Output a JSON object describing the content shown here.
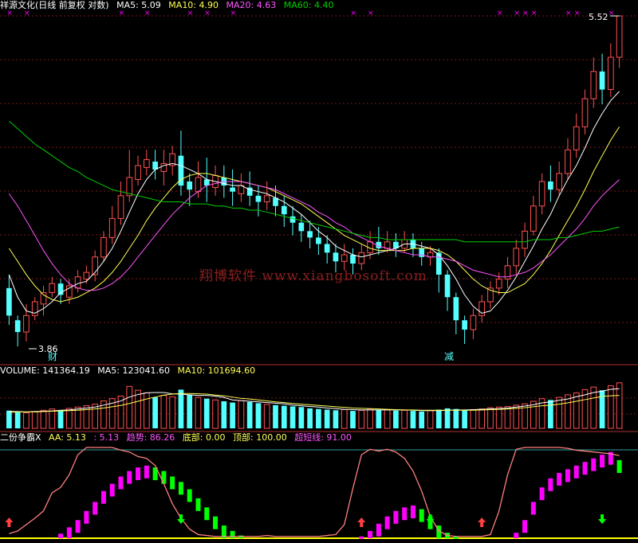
{
  "price_header": {
    "name": "祥源文化(日线 前复权 对数)",
    "ma5": "MA5: 5.09",
    "ma10": "MA10: 4.90",
    "ma20": "MA20: 4.63",
    "ma60": "MA60: 4.40"
  },
  "volume_header": {
    "volume": "VOLUME: 141364.19",
    "ma5": "MA5: 123041.60",
    "ma10": "MA10: 101694.60"
  },
  "indicator_header": {
    "name": "二份争霸X",
    "aa": "AA: 5.13",
    "aa2": ": 5.13",
    "trend": "趋势: 86.26",
    "bottom": "底部: 0.00",
    "top": "顶部: 100.00",
    "overshort": "超短线: 91.00"
  },
  "watermark": "翔博软件 www.xiangbosoft.com",
  "annotations": {
    "high_label": "5.52",
    "low_label": "3.86",
    "marker_cai": "财",
    "marker_jian": "减"
  },
  "colors": {
    "up": "#ff5050",
    "down": "#54ffff",
    "ma5": "#ffffff",
    "ma10": "#ffff54",
    "ma20": "#ff54ff",
    "ma60": "#00d000",
    "trend": "#ff7f7f",
    "bar_up": "#ff00ff",
    "bar_flat": "#00ff00",
    "top_marker": "#ff00ff",
    "watermark": "#8a1f1f"
  },
  "chart_data": {
    "type": "candlestick",
    "scale": "log",
    "price_range": [
      3.86,
      5.52
    ],
    "price_candles": [
      [
        4.12,
        4.0,
        4.18,
        3.96
      ],
      [
        3.98,
        3.93,
        4.0,
        3.87
      ],
      [
        3.93,
        4.0,
        4.05,
        3.89
      ],
      [
        4.0,
        4.06,
        4.08,
        3.98
      ],
      [
        4.05,
        4.1,
        4.13,
        4.0
      ],
      [
        4.1,
        4.14,
        4.17,
        4.08
      ],
      [
        4.14,
        4.09,
        4.16,
        4.05
      ],
      [
        4.08,
        4.13,
        4.16,
        4.05
      ],
      [
        4.12,
        4.17,
        4.2,
        4.1
      ],
      [
        4.16,
        4.19,
        4.22,
        4.14
      ],
      [
        4.18,
        4.26,
        4.29,
        4.15
      ],
      [
        4.26,
        4.35,
        4.38,
        4.24
      ],
      [
        4.35,
        4.44,
        4.5,
        4.32
      ],
      [
        4.44,
        4.55,
        4.62,
        4.41
      ],
      [
        4.55,
        4.64,
        4.78,
        4.52
      ],
      [
        4.63,
        4.7,
        4.75,
        4.6
      ],
      [
        4.69,
        4.73,
        4.78,
        4.65
      ],
      [
        4.72,
        4.68,
        4.78,
        4.63
      ],
      [
        4.67,
        4.71,
        4.78,
        4.6
      ],
      [
        4.7,
        4.76,
        4.8,
        4.65
      ],
      [
        4.75,
        4.6,
        4.88,
        4.55
      ],
      [
        4.62,
        4.58,
        4.66,
        4.5
      ],
      [
        4.57,
        4.64,
        4.72,
        4.54
      ],
      [
        4.63,
        4.6,
        4.74,
        4.52
      ],
      [
        4.59,
        4.65,
        4.7,
        4.55
      ],
      [
        4.64,
        4.6,
        4.7,
        4.54
      ],
      [
        4.59,
        4.57,
        4.68,
        4.5
      ],
      [
        4.56,
        4.6,
        4.66,
        4.52
      ],
      [
        4.59,
        4.55,
        4.67,
        4.5
      ],
      [
        4.55,
        4.52,
        4.6,
        4.45
      ],
      [
        4.52,
        4.55,
        4.62,
        4.48
      ],
      [
        4.54,
        4.5,
        4.6,
        4.45
      ],
      [
        4.5,
        4.46,
        4.55,
        4.4
      ],
      [
        4.45,
        4.42,
        4.5,
        4.36
      ],
      [
        4.42,
        4.38,
        4.46,
        4.33
      ],
      [
        4.38,
        4.35,
        4.43,
        4.3
      ],
      [
        4.35,
        4.32,
        4.4,
        4.27
      ],
      [
        4.32,
        4.28,
        4.36,
        4.23
      ],
      [
        4.28,
        4.24,
        4.32,
        4.19
      ],
      [
        4.24,
        4.27,
        4.32,
        4.2
      ],
      [
        4.27,
        4.23,
        4.3,
        4.18
      ],
      [
        4.23,
        4.28,
        4.32,
        4.2
      ],
      [
        4.28,
        4.33,
        4.38,
        4.25
      ],
      [
        4.33,
        4.3,
        4.4,
        4.27
      ],
      [
        4.3,
        4.33,
        4.38,
        4.28
      ],
      [
        4.33,
        4.3,
        4.37,
        4.26
      ],
      [
        4.3,
        4.34,
        4.38,
        4.28
      ],
      [
        4.34,
        4.3,
        4.37,
        4.26
      ],
      [
        4.3,
        4.26,
        4.33,
        4.22
      ],
      [
        4.26,
        4.28,
        4.31,
        4.22
      ],
      [
        4.28,
        4.18,
        4.3,
        4.1
      ],
      [
        4.18,
        4.08,
        4.2,
        4.02
      ],
      [
        4.08,
        3.98,
        4.1,
        3.92
      ],
      [
        3.98,
        3.94,
        4.0,
        3.88
      ],
      [
        3.94,
        4.0,
        4.03,
        3.9
      ],
      [
        4.0,
        4.06,
        4.09,
        3.97
      ],
      [
        4.06,
        4.12,
        4.15,
        4.03
      ],
      [
        4.12,
        4.16,
        4.19,
        4.09
      ],
      [
        4.16,
        4.22,
        4.26,
        4.12
      ],
      [
        4.22,
        4.3,
        4.34,
        4.18
      ],
      [
        4.3,
        4.38,
        4.42,
        4.26
      ],
      [
        4.38,
        4.5,
        4.55,
        4.36
      ],
      [
        4.5,
        4.62,
        4.66,
        4.46
      ],
      [
        4.62,
        4.58,
        4.7,
        4.52
      ],
      [
        4.58,
        4.66,
        4.72,
        4.55
      ],
      [
        4.66,
        4.78,
        4.84,
        4.63
      ],
      [
        4.78,
        4.9,
        4.97,
        4.74
      ],
      [
        4.9,
        5.05,
        5.1,
        4.86
      ],
      [
        5.05,
        5.2,
        5.28,
        5.0
      ],
      [
        5.2,
        5.1,
        5.3,
        5.02
      ],
      [
        5.1,
        5.28,
        5.36,
        5.06
      ],
      [
        5.28,
        5.52,
        5.52,
        5.22
      ]
    ],
    "ma": {
      "MA5": [
        4.18,
        4.08,
        4.02,
        4.01,
        4.03,
        4.06,
        4.1,
        4.12,
        4.14,
        4.15,
        4.19,
        4.24,
        4.3,
        4.38,
        4.47,
        4.56,
        4.63,
        4.68,
        4.7,
        4.71,
        4.7,
        4.68,
        4.66,
        4.63,
        4.62,
        4.61,
        4.6,
        4.6,
        4.58,
        4.57,
        4.56,
        4.54,
        4.52,
        4.49,
        4.46,
        4.42,
        4.38,
        4.35,
        4.31,
        4.29,
        4.27,
        4.26,
        4.27,
        4.28,
        4.29,
        4.3,
        4.32,
        4.32,
        4.31,
        4.3,
        4.27,
        4.22,
        4.16,
        4.09,
        4.04,
        4.01,
        4.02,
        4.06,
        4.11,
        4.17,
        4.24,
        4.31,
        4.39,
        4.46,
        4.55,
        4.63,
        4.7,
        4.79,
        4.89,
        4.97,
        5.04,
        5.09
      ],
      "MA10": [
        4.3,
        4.24,
        4.18,
        4.13,
        4.09,
        4.07,
        4.06,
        4.07,
        4.08,
        4.1,
        4.12,
        4.15,
        4.19,
        4.24,
        4.3,
        4.36,
        4.43,
        4.49,
        4.54,
        4.59,
        4.63,
        4.65,
        4.66,
        4.66,
        4.65,
        4.64,
        4.63,
        4.62,
        4.61,
        4.6,
        4.59,
        4.57,
        4.55,
        4.53,
        4.51,
        4.48,
        4.45,
        4.42,
        4.39,
        4.36,
        4.34,
        4.32,
        4.3,
        4.29,
        4.29,
        4.29,
        4.29,
        4.3,
        4.3,
        4.3,
        4.29,
        4.27,
        4.24,
        4.2,
        4.16,
        4.13,
        4.11,
        4.1,
        4.1,
        4.12,
        4.14,
        4.18,
        4.23,
        4.29,
        4.36,
        4.43,
        4.5,
        4.58,
        4.67,
        4.75,
        4.83,
        4.9
      ],
      "MA20": [
        4.56,
        4.5,
        4.43,
        4.36,
        4.29,
        4.23,
        4.18,
        4.14,
        4.12,
        4.11,
        4.11,
        4.12,
        4.14,
        4.17,
        4.21,
        4.26,
        4.31,
        4.36,
        4.41,
        4.46,
        4.5,
        4.54,
        4.57,
        4.6,
        4.61,
        4.62,
        4.62,
        4.62,
        4.61,
        4.6,
        4.59,
        4.58,
        4.56,
        4.54,
        4.52,
        4.5,
        4.47,
        4.45,
        4.42,
        4.4,
        4.37,
        4.35,
        4.33,
        4.31,
        4.3,
        4.29,
        4.28,
        4.27,
        4.27,
        4.26,
        4.26,
        4.25,
        4.24,
        4.22,
        4.2,
        4.19,
        4.18,
        4.17,
        4.17,
        4.18,
        4.19,
        4.21,
        4.24,
        4.27,
        4.31,
        4.35,
        4.39,
        4.44,
        4.5,
        4.55,
        4.59,
        4.63
      ],
      "MA60": [
        4.93,
        4.89,
        4.85,
        4.81,
        4.78,
        4.75,
        4.72,
        4.69,
        4.67,
        4.64,
        4.62,
        4.6,
        4.58,
        4.57,
        4.56,
        4.55,
        4.54,
        4.53,
        4.52,
        4.52,
        4.52,
        4.51,
        4.51,
        4.51,
        4.5,
        4.5,
        4.49,
        4.49,
        4.48,
        4.48,
        4.47,
        4.46,
        4.45,
        4.44,
        4.43,
        4.42,
        4.41,
        4.4,
        4.39,
        4.38,
        4.37,
        4.36,
        4.35,
        4.35,
        4.34,
        4.34,
        4.34,
        4.34,
        4.34,
        4.34,
        4.34,
        4.34,
        4.34,
        4.33,
        4.33,
        4.33,
        4.33,
        4.33,
        4.33,
        4.33,
        4.33,
        4.34,
        4.34,
        4.34,
        4.35,
        4.35,
        4.36,
        4.37,
        4.38,
        4.38,
        4.39,
        4.4
      ]
    },
    "volume": [
      55,
      50,
      48,
      52,
      56,
      60,
      54,
      62,
      66,
      70,
      75,
      85,
      92,
      100,
      130,
      118,
      110,
      96,
      102,
      98,
      120,
      104,
      96,
      92,
      88,
      84,
      80,
      86,
      82,
      78,
      74,
      72,
      70,
      68,
      66,
      62,
      60,
      58,
      56,
      58,
      54,
      56,
      60,
      58,
      57,
      55,
      56,
      54,
      52,
      55,
      58,
      62,
      60,
      56,
      58,
      60,
      64,
      66,
      68,
      72,
      76,
      84,
      92,
      88,
      96,
      104,
      110,
      120,
      128,
      118,
      132,
      141
    ],
    "volume_ma": {
      "MA5": [
        52,
        52,
        51,
        52,
        53,
        54,
        56,
        57,
        60,
        63,
        66,
        72,
        78,
        85,
        97,
        105,
        110,
        111,
        111,
        107,
        106,
        104,
        102,
        102,
        100,
        96,
        88,
        86,
        84,
        82,
        80,
        78,
        76,
        72,
        70,
        68,
        66,
        63,
        61,
        59,
        58,
        57,
        57,
        57,
        57,
        57,
        57,
        56,
        55,
        55,
        55,
        56,
        57,
        57,
        58,
        59,
        60,
        61,
        63,
        66,
        69,
        73,
        79,
        82,
        87,
        91,
        98,
        104,
        111,
        115,
        121,
        123
      ],
      "MA10": [
        50,
        51,
        51,
        51,
        52,
        53,
        54,
        55,
        56,
        58,
        60,
        63,
        67,
        71,
        77,
        84,
        91,
        97,
        103,
        106,
        108,
        108,
        107,
        106,
        103,
        101,
        97,
        93,
        91,
        88,
        85,
        82,
        80,
        77,
        75,
        73,
        71,
        69,
        67,
        65,
        63,
        62,
        61,
        60,
        59,
        58,
        57,
        57,
        56,
        56,
        56,
        56,
        56,
        56,
        56,
        57,
        58,
        59,
        60,
        62,
        64,
        67,
        70,
        72,
        75,
        79,
        84,
        89,
        94,
        99,
        101,
        102
      ]
    },
    "trend_range": [
      0,
      100
    ],
    "trend": [
      5,
      8,
      15,
      22,
      30,
      50,
      56,
      70,
      92,
      100,
      100,
      100,
      100,
      97,
      95,
      90,
      88,
      80,
      60,
      38,
      22,
      10,
      4,
      3,
      2,
      2,
      2,
      2,
      2,
      2,
      3,
      2,
      2,
      2,
      2,
      2,
      2,
      3,
      4,
      15,
      55,
      92,
      98,
      96,
      98,
      95,
      88,
      74,
      52,
      24,
      8,
      3,
      2,
      2,
      2,
      2,
      4,
      30,
      70,
      98,
      100,
      100,
      100,
      100,
      100,
      99,
      97,
      96,
      95,
      94,
      93,
      91
    ],
    "trend_bars": [
      0,
      0,
      0,
      0,
      0,
      0,
      5,
      12,
      20,
      30,
      40,
      52,
      60,
      68,
      74,
      78,
      80,
      78,
      74,
      68,
      62,
      54,
      44,
      34,
      24,
      14,
      8,
      3,
      0,
      0,
      0,
      0,
      0,
      0,
      0,
      0,
      0,
      0,
      0,
      0,
      0,
      2,
      8,
      16,
      24,
      30,
      34,
      36,
      32,
      24,
      14,
      6,
      2,
      0,
      0,
      0,
      0,
      0,
      0,
      6,
      20,
      40,
      56,
      66,
      72,
      76,
      80,
      84,
      88,
      92,
      95,
      86
    ],
    "signals": {
      "up_arrows": [
        0,
        41,
        55
      ],
      "down_arrows": [
        20,
        49,
        69
      ],
      "top_markers": [
        0,
        2,
        13,
        16,
        21,
        23,
        26,
        40,
        42,
        57,
        59,
        60,
        61,
        65,
        66,
        70
      ]
    }
  }
}
